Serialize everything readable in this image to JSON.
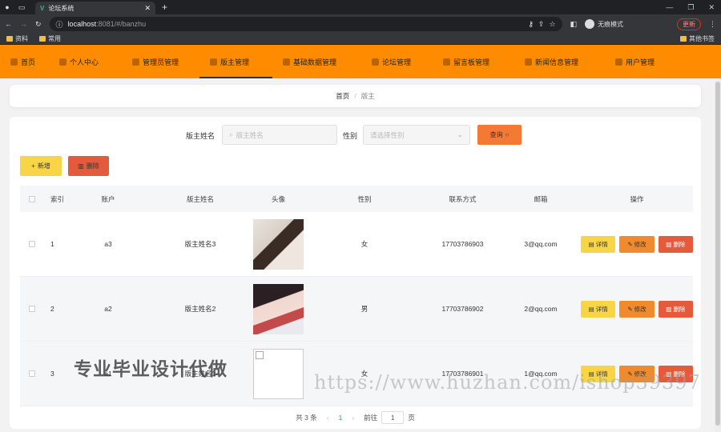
{
  "browser": {
    "tab_title": "论坛系统",
    "url_host": "localhost",
    "url_path": ":8081/#/banzhu",
    "incognito_label": "无痕模式",
    "update_label": "更新",
    "bookmarks": [
      "资料",
      "常用"
    ],
    "other_bookmarks": "其他书签"
  },
  "nav": {
    "items": [
      {
        "label": "首页"
      },
      {
        "label": "个人中心"
      },
      {
        "label": "管理员管理"
      },
      {
        "label": "版主管理"
      },
      {
        "label": "基础数据管理"
      },
      {
        "label": "论坛管理"
      },
      {
        "label": "留言板管理"
      },
      {
        "label": "新闻信息管理"
      },
      {
        "label": "用户管理"
      }
    ],
    "active_index": 3,
    "bg_color": "#ff8c00"
  },
  "breadcrumb": {
    "home": "首页",
    "sep": "/",
    "current": "版主"
  },
  "search": {
    "name_label": "版主姓名",
    "name_placeholder": "版主姓名",
    "gender_label": "性别",
    "gender_placeholder": "请选择性别",
    "query_label": "查询"
  },
  "actions": {
    "add_label": "新增",
    "delete_label": "删除"
  },
  "table": {
    "headers": [
      "索引",
      "账户",
      "版主姓名",
      "头像",
      "性别",
      "联系方式",
      "邮箱",
      "操作"
    ],
    "rows": [
      {
        "index": "1",
        "account": "a3",
        "name": "版主姓名3",
        "gender": "女",
        "phone": "17703786903",
        "email": "3@qq.com"
      },
      {
        "index": "2",
        "account": "a2",
        "name": "版主姓名2",
        "gender": "男",
        "phone": "17703786902",
        "email": "2@qq.com"
      },
      {
        "index": "3",
        "account": "a1",
        "name": "版主姓名1",
        "gender": "女",
        "phone": "17703786901",
        "email": "1@qq.com"
      }
    ],
    "row_actions": {
      "detail": "详情",
      "edit": "修改",
      "delete": "删除"
    }
  },
  "pager": {
    "total": "共 3 条",
    "prev": "‹",
    "current": "1",
    "next": "›",
    "goto_prefix": "前往",
    "goto_value": "1",
    "goto_suffix": "页"
  },
  "watermarks": {
    "left": "专业毕业设计代做",
    "right": "https://www.huzhan.com/ishop39397"
  }
}
